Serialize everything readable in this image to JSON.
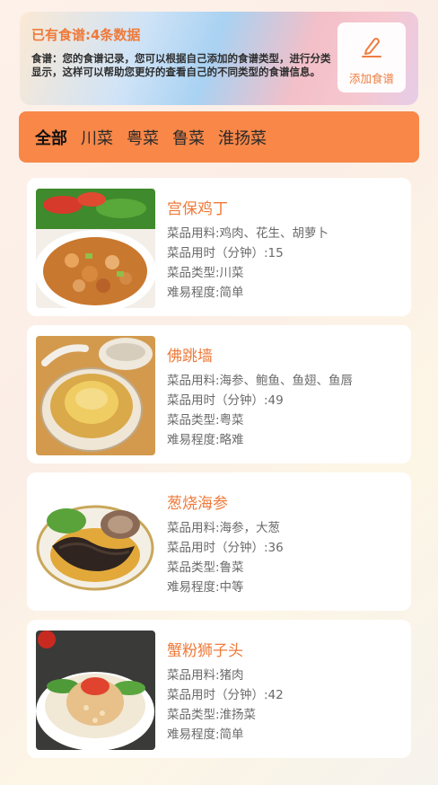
{
  "header": {
    "title": "已有食谱:4条数据",
    "description": "食谱：您的食谱记录，您可以根据自己添加的食谱类型，进行分类显示，这样可以帮助您更好的查看自己的不同类型的食谱信息。",
    "add_label": "添加食谱",
    "add_icon": "edit-pen-icon"
  },
  "tabs": [
    {
      "label": "全部"
    },
    {
      "label": "川菜"
    },
    {
      "label": "粤菜"
    },
    {
      "label": "鲁菜"
    },
    {
      "label": "淮扬菜"
    }
  ],
  "colors": {
    "accent": "#ef7a3a",
    "tabbar": "#f88748"
  },
  "recipes": [
    {
      "name": "宫保鸡丁",
      "ingredients": "菜品用料:鸡肉、花生、胡萝卜",
      "time": "菜品用时（分钟）:15",
      "category": "菜品类型:川菜",
      "difficulty": "难易程度:简单"
    },
    {
      "name": "佛跳墙",
      "ingredients": "菜品用料:海参、鲍鱼、鱼翅、鱼唇",
      "time": "菜品用时（分钟）:49",
      "category": "菜品类型:粤菜",
      "difficulty": "难易程度:略难"
    },
    {
      "name": "葱烧海参",
      "ingredients": "菜品用料:海参，大葱",
      "time": "菜品用时（分钟）:36",
      "category": "菜品类型:鲁菜",
      "difficulty": "难易程度:中等"
    },
    {
      "name": "蟹粉狮子头",
      "ingredients": "菜品用料:猪肉",
      "time": "菜品用时（分钟）:42",
      "category": "菜品类型:淮扬菜",
      "difficulty": "难易程度:简单"
    }
  ]
}
